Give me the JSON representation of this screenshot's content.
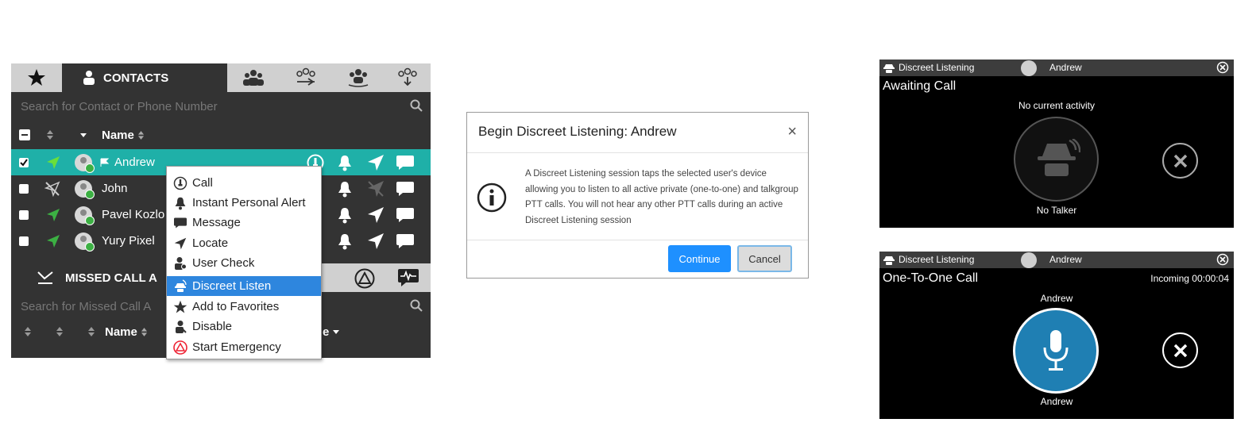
{
  "contacts_panel": {
    "tabs": {
      "favorites_icon": "star-icon",
      "contacts_label": "CONTACTS",
      "icon_tabs": [
        "group-icon",
        "group-send-icon",
        "group-talk-icon",
        "group-download-icon"
      ]
    },
    "search_placeholder": "Search for Contact or Phone Number",
    "header": {
      "name_label": "Name"
    },
    "rows": [
      {
        "name": "Andrew",
        "selected": true
      },
      {
        "name": "John",
        "selected": false
      },
      {
        "name": "Pavel Kozlo",
        "selected": false
      },
      {
        "name": "Yury Pixel",
        "selected": false
      }
    ],
    "missed_call": {
      "tab_label": "MISSED CALL A",
      "search_placeholder": "Search for Missed Call A",
      "name_label": "Name",
      "col_suffix": "e"
    },
    "context_menu": {
      "items": [
        {
          "label": "Call",
          "icon": "call-icon"
        },
        {
          "label": "Instant Personal Alert",
          "icon": "bell-icon"
        },
        {
          "label": "Message",
          "icon": "message-icon"
        },
        {
          "label": "Locate",
          "icon": "locate-icon"
        },
        {
          "label": "User Check",
          "icon": "user-check-icon"
        },
        {
          "label": "Discreet Listen",
          "icon": "discreet-listen-icon",
          "active": true
        },
        {
          "label": "Add to Favorites",
          "icon": "star-icon"
        },
        {
          "label": "Disable",
          "icon": "disable-icon"
        },
        {
          "label": "Start Emergency",
          "icon": "emergency-icon"
        }
      ]
    }
  },
  "dialog": {
    "title": "Begin Discreet Listening:  Andrew",
    "close_symbol": "×",
    "body": "A Discreet Listening session taps the selected user's device allowing you to listen to all active private (one-to-one) and talkgroup PTT calls. You will not hear any other PTT calls during an active Discreet Listening session",
    "continue_label": "Continue",
    "cancel_label": "Cancel"
  },
  "listening_awaiting": {
    "title": "Discreet Listening",
    "user": "Andrew",
    "state": "Awaiting Call",
    "activity": "No current activity",
    "talker": "No Talker"
  },
  "listening_call": {
    "title": "Discreet Listening",
    "user": "Andrew",
    "state": "One-To-One Call",
    "status": "Incoming 00:00:04",
    "caller_top": "Andrew",
    "caller_bottom": "Andrew"
  },
  "colors": {
    "selected_row": "#1fb0a8",
    "accent_blue": "#1e90ff",
    "mic_blue": "#1f7fb3"
  }
}
